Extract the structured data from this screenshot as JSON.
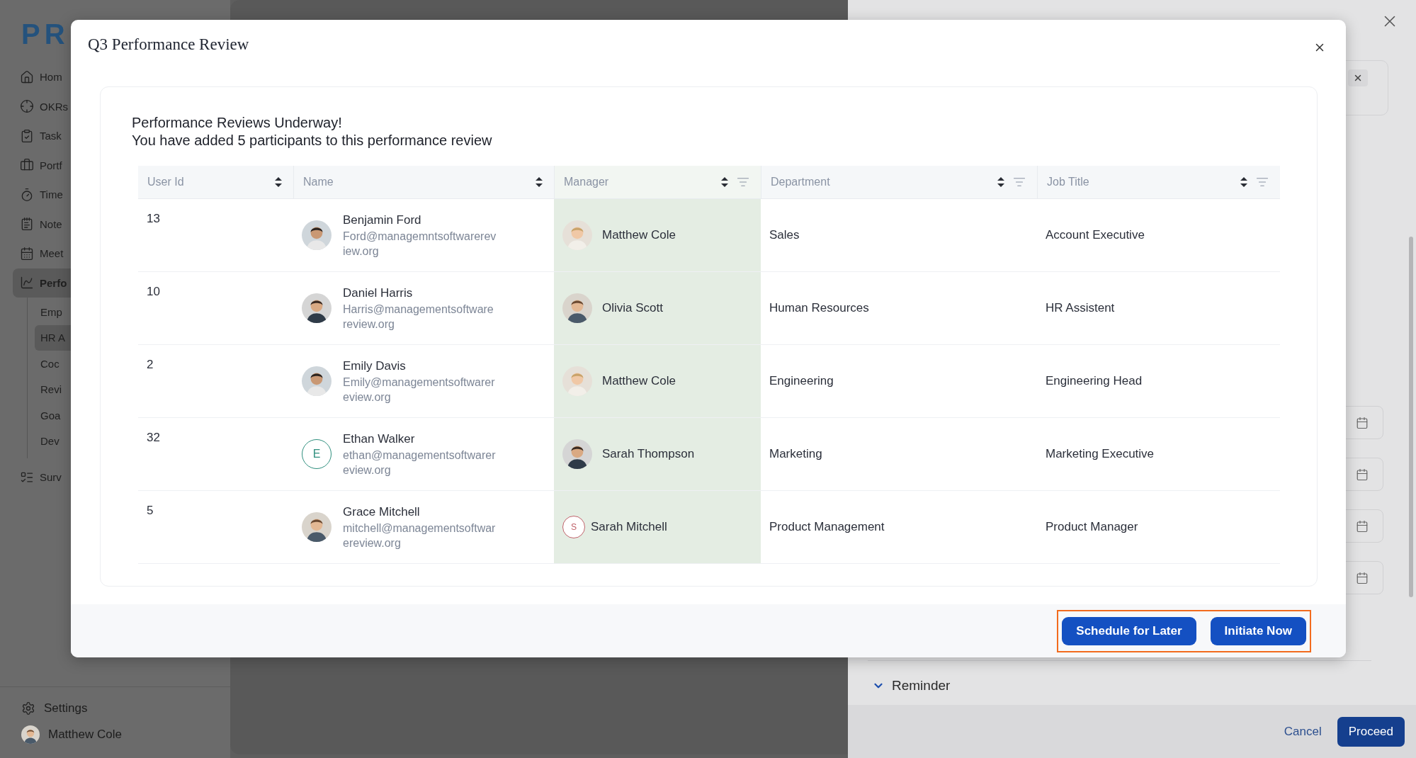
{
  "sidebar": {
    "logo": "PR",
    "items": [
      {
        "label": "Hom",
        "selected": false
      },
      {
        "label": "OKRs",
        "selected": false
      },
      {
        "label": "Task",
        "selected": false
      },
      {
        "label": "Portf",
        "selected": false
      },
      {
        "label": "Time",
        "selected": false
      },
      {
        "label": "Note",
        "selected": false
      },
      {
        "label": "Meet",
        "selected": false
      },
      {
        "label": "Perfo",
        "selected": true,
        "children": [
          {
            "label": "Emp",
            "selected": false
          },
          {
            "label": "HR A",
            "selected": true
          },
          {
            "label": "Coc",
            "selected": false
          },
          {
            "label": "Revi",
            "selected": false
          },
          {
            "label": "Goa",
            "selected": false
          },
          {
            "label": "Dev",
            "selected": false
          }
        ]
      },
      {
        "label": "Surv",
        "selected": false
      }
    ],
    "settings": "Settings",
    "user": {
      "name": "Matthew Cole",
      "avatar": {
        "kind": "photo"
      }
    }
  },
  "drawer": {
    "section": "Reminder",
    "expanded": true,
    "buttons": [
      {
        "label": "Cancel",
        "kind": "link"
      },
      {
        "label": "Proceed",
        "kind": "primary"
      }
    ]
  },
  "modal": {
    "title": "Q3 Performance Review",
    "heading": "Performance Reviews Underway!",
    "subheading": "You have added 5 participants to this performance review",
    "table": {
      "columns": [
        {
          "label": "User Id",
          "sortable": true,
          "filterable": false,
          "highlighted": false
        },
        {
          "label": "Name",
          "sortable": true,
          "filterable": false,
          "highlighted": false
        },
        {
          "label": "Manager",
          "sortable": true,
          "filterable": true,
          "highlighted": true
        },
        {
          "label": "Department",
          "sortable": true,
          "filterable": true,
          "highlighted": false
        },
        {
          "label": "Job Title",
          "sortable": true,
          "filterable": true,
          "highlighted": false
        }
      ],
      "rows": [
        {
          "user_id": "13",
          "name": "Benjamin Ford",
          "email": "Ford@managemntsoftwarereview.org",
          "avatar": {
            "kind": "photo"
          },
          "manager": {
            "name": "Matthew Cole",
            "avatar": {
              "kind": "photo"
            }
          },
          "department": "Sales",
          "job_title": "Account Executive"
        },
        {
          "user_id": "10",
          "name": "Daniel Harris",
          "email": "Harris@managementsoftwarereview.org",
          "avatar": {
            "kind": "photo"
          },
          "manager": {
            "name": "Olivia Scott",
            "avatar": {
              "kind": "photo"
            }
          },
          "department": "Human Resources",
          "job_title": "HR Assistent"
        },
        {
          "user_id": "2",
          "name": "Emily Davis",
          "email": "Emily@managementsoftwarereview.org",
          "avatar": {
            "kind": "photo"
          },
          "manager": {
            "name": "Matthew Cole",
            "avatar": {
              "kind": "photo"
            }
          },
          "department": "Engineering",
          "job_title": "Engineering Head"
        },
        {
          "user_id": "32",
          "name": "Ethan Walker",
          "email": "ethan@managementsoftwarereview.org",
          "avatar": {
            "kind": "initial",
            "letter": "E",
            "color": "#2f8f7e"
          },
          "manager": {
            "name": "Sarah Thompson",
            "avatar": {
              "kind": "photo"
            }
          },
          "department": "Marketing",
          "job_title": "Marketing Executive"
        },
        {
          "user_id": "5",
          "name": "Grace Mitchell",
          "email": "mitchell@managementsoftwarereview.org",
          "avatar": {
            "kind": "photo"
          },
          "manager": {
            "name": "Sarah Mitchell",
            "avatar": {
              "kind": "initial",
              "letter": "S",
              "color": "#c0636b"
            }
          },
          "department": "Product Management",
          "job_title": "Product Manager"
        }
      ]
    },
    "footer": {
      "highlighted": true,
      "buttons": [
        {
          "label": "Schedule for Later",
          "kind": "primary"
        },
        {
          "label": "Initiate Now",
          "kind": "primary"
        }
      ]
    }
  }
}
